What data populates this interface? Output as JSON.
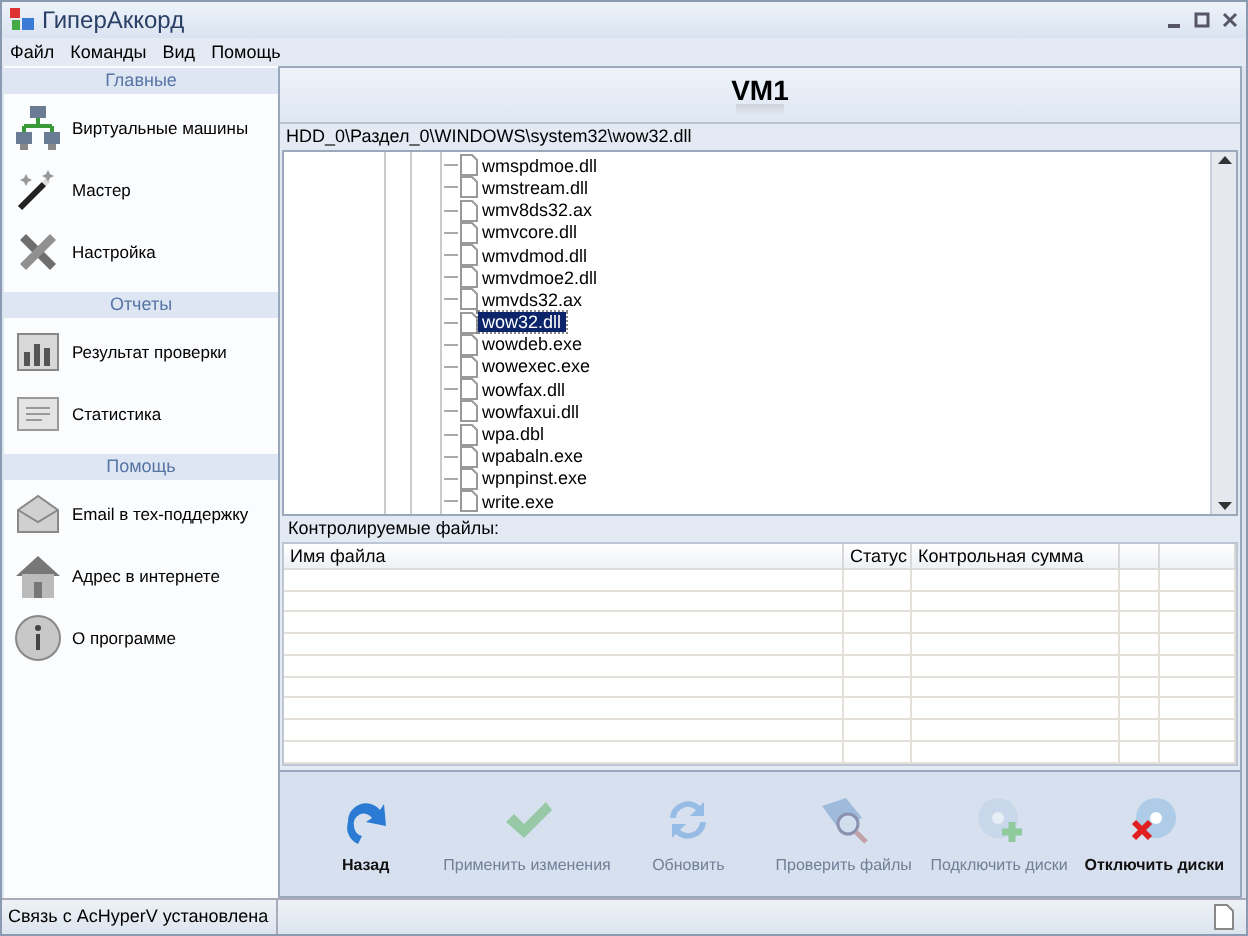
{
  "window": {
    "title": "ГиперАккорд"
  },
  "menu": [
    {
      "label": "Файл"
    },
    {
      "label": "Команды"
    },
    {
      "label": "Вид"
    },
    {
      "label": "Помощь"
    }
  ],
  "sidebar": [
    {
      "title": "Главные",
      "items": [
        {
          "label": "Виртуальные машины"
        },
        {
          "label": "Мастер"
        },
        {
          "label": "Настройка"
        }
      ]
    },
    {
      "title": "Отчеты",
      "items": [
        {
          "label": "Результат проверки"
        },
        {
          "label": "Статистика"
        }
      ]
    },
    {
      "title": "Помощь",
      "items": [
        {
          "label": "Email в тех-поддержку"
        },
        {
          "label": "Адрес в интернете"
        },
        {
          "label": "О программе"
        }
      ]
    }
  ],
  "header": {
    "title": "VM1"
  },
  "path": "HDD_0\\Раздел_0\\WINDOWS\\system32\\wow32.dll",
  "tree": {
    "items": [
      {
        "label": "wmspdmoe.dll",
        "selected": false
      },
      {
        "label": "wmstream.dll",
        "selected": false
      },
      {
        "label": "wmv8ds32.ax",
        "selected": false
      },
      {
        "label": "wmvcore.dll",
        "selected": false
      },
      {
        "label": "wmvdmod.dll",
        "selected": false
      },
      {
        "label": "wmvdmoe2.dll",
        "selected": false
      },
      {
        "label": "wmvds32.ax",
        "selected": false
      },
      {
        "label": "wow32.dll",
        "selected": true
      },
      {
        "label": "wowdeb.exe",
        "selected": false
      },
      {
        "label": "wowexec.exe",
        "selected": false
      },
      {
        "label": "wowfax.dll",
        "selected": false
      },
      {
        "label": "wowfaxui.dll",
        "selected": false
      },
      {
        "label": "wpa.dbl",
        "selected": false
      },
      {
        "label": "wpabaln.exe",
        "selected": false
      },
      {
        "label": "wpnpinst.exe",
        "selected": false
      },
      {
        "label": "write.exe",
        "selected": false
      }
    ]
  },
  "monitored": {
    "label": "Контролируемые файлы:",
    "columns": [
      "Имя файла",
      "Статус",
      "Контрольная сумма"
    ]
  },
  "toolbar": [
    {
      "label": "Назад",
      "disabled": false
    },
    {
      "label": "Применить изменения",
      "disabled": true
    },
    {
      "label": "Обновить",
      "disabled": true
    },
    {
      "label": "Проверить файлы",
      "disabled": true
    },
    {
      "label": "Подключить диски",
      "disabled": true
    },
    {
      "label": "Отключить диски",
      "disabled": false
    }
  ],
  "status_bar": {
    "text": "Связь с AcHyperV установлена"
  }
}
